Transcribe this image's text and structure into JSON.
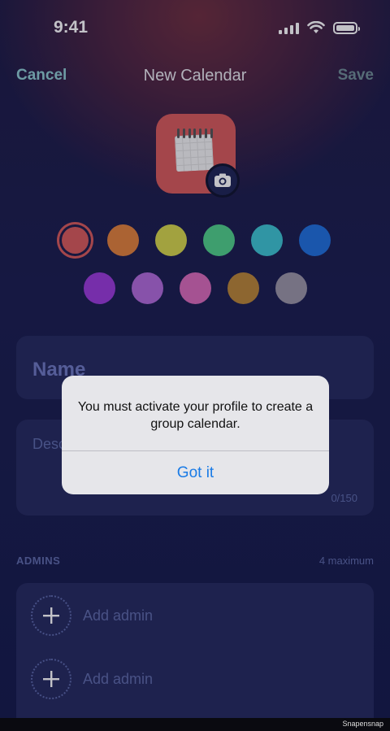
{
  "status_bar": {
    "time": "9:41"
  },
  "nav": {
    "cancel": "Cancel",
    "title": "New Calendar",
    "save": "Save"
  },
  "calendar_icon": {
    "name": "calendar-icon",
    "badge_icon": "camera-icon",
    "color": "#d75a5a"
  },
  "colors": {
    "row1": [
      "#d75a5a",
      "#e0803a",
      "#d4d54a",
      "#4fcf88",
      "#3cc3d1",
      "#1f6fdb"
    ],
    "row2": [
      "#9a3ad8",
      "#b06ad8",
      "#d86ab8",
      "#b98436",
      "#9a95a4"
    ],
    "selected": "#d75a5a"
  },
  "form": {
    "name_placeholder": "Name",
    "description_placeholder": "Desc",
    "description_count": "0/150"
  },
  "admins": {
    "label": "ADMINS",
    "maximum": "4 maximum",
    "add_label_1": "Add admin",
    "add_label_2": "Add admin"
  },
  "alert": {
    "message": "You must activate your profile to create a group calendar.",
    "button": "Got it"
  },
  "watermark": "Snapensnap"
}
